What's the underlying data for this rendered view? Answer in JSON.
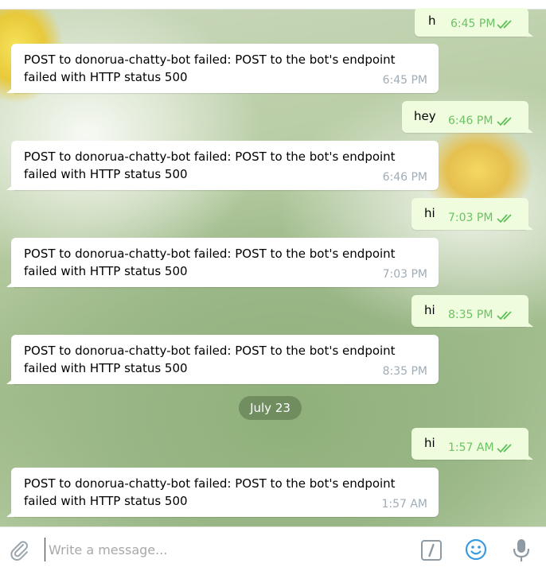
{
  "messages": [
    {
      "dir": "out",
      "text": "h",
      "time": "6:45 PM",
      "read": true
    },
    {
      "dir": "in",
      "text": "POST to donorua-chatty-bot failed: POST to the bot's endpoint failed with HTTP status 500",
      "time": "6:45 PM"
    },
    {
      "dir": "out",
      "text": "hey",
      "time": "6:46 PM",
      "read": true
    },
    {
      "dir": "in",
      "text": "POST to donorua-chatty-bot failed: POST to the bot's endpoint failed with HTTP status 500",
      "time": "6:46 PM"
    },
    {
      "dir": "out",
      "text": "hi",
      "time": "7:03 PM",
      "read": true
    },
    {
      "dir": "in",
      "text": "POST to donorua-chatty-bot failed: POST to the bot's endpoint failed with HTTP status 500",
      "time": "7:03 PM"
    },
    {
      "dir": "out",
      "text": "hi",
      "time": "8:35 PM",
      "read": true
    },
    {
      "dir": "in",
      "text": "POST to donorua-chatty-bot failed: POST to the bot's endpoint failed with HTTP status 500",
      "time": "8:35 PM"
    },
    {
      "dir": "out",
      "text": "hi",
      "time": "1:57 AM",
      "read": true
    },
    {
      "dir": "in",
      "text": "POST to donorua-chatty-bot failed: POST to the bot's endpoint failed with HTTP status 500",
      "time": "1:57 AM"
    }
  ],
  "date_separator": "July 23",
  "composer": {
    "placeholder": "Write a message...",
    "value": "",
    "icons": {
      "attach": "paperclip-icon",
      "commands": "bot-commands-icon",
      "emoji": "emoji-icon",
      "voice": "microphone-icon"
    }
  },
  "colors": {
    "incoming_bubble": "#ffffff",
    "outgoing_bubble": "#effdde",
    "outgoing_time": "#6cc264",
    "read_check": "#5fc05a",
    "incoming_time": "#a0acb6",
    "date_chip": "#64805a",
    "icon_blue": "#3a9ae0",
    "icon_gray": "#8e9aa4"
  }
}
